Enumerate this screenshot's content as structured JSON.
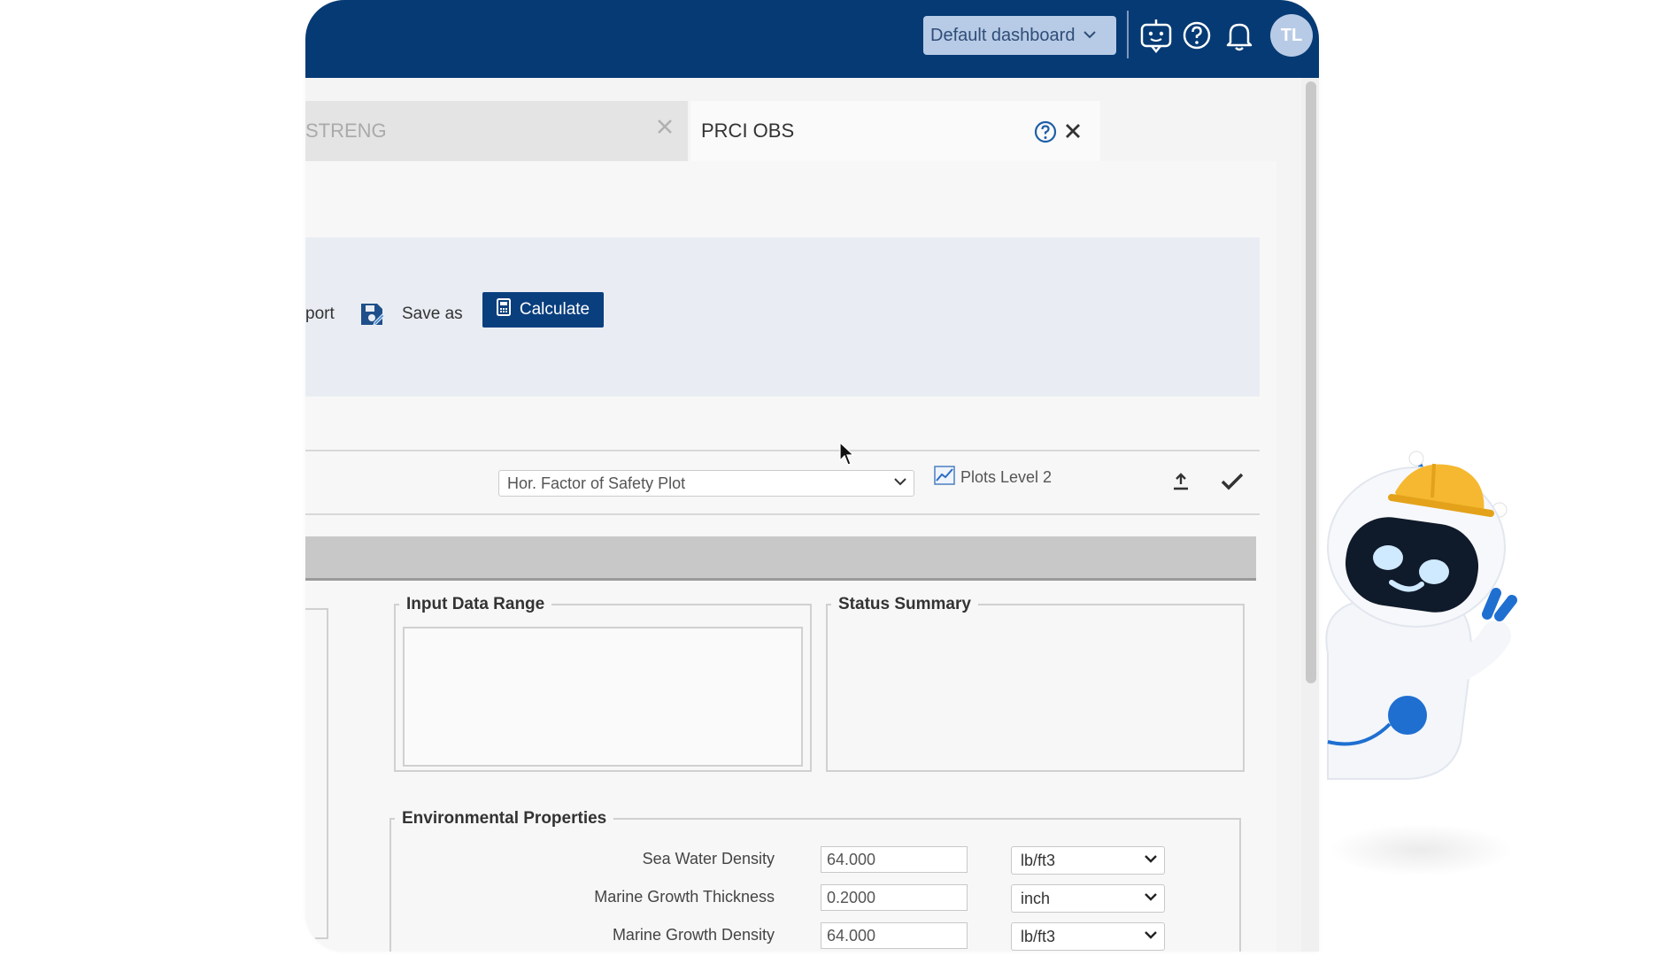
{
  "topbar": {
    "dashboard_select": "Default dashboard",
    "user_initials": "TL"
  },
  "tabs": [
    {
      "label": "STRENG",
      "active": false
    },
    {
      "label": "PRCI OBS",
      "active": true
    }
  ],
  "toolbar": {
    "report_label": "port",
    "save_as_label": "Save as",
    "calculate_label": "Calculate"
  },
  "plot_controls": {
    "plot_select_value": "Hor. Factor of Safety Plot",
    "plots_level_label": "Plots Level 2"
  },
  "panels": {
    "input_data_range_title": "Input Data Range",
    "status_summary_title": "Status Summary"
  },
  "environmental": {
    "title": "Environmental Properties",
    "rows": [
      {
        "label": "Sea Water Density",
        "value": "64.000",
        "unit": "lb/ft3"
      },
      {
        "label": "Marine Growth Thickness",
        "value": "0.2000",
        "unit": "inch"
      },
      {
        "label": "Marine Growth Density",
        "value": "64.000",
        "unit": "lb/ft3"
      }
    ]
  },
  "colors": {
    "header": "#063a74",
    "primary_button": "#0a3f7e",
    "toolbar_bg": "#e9edf3"
  }
}
